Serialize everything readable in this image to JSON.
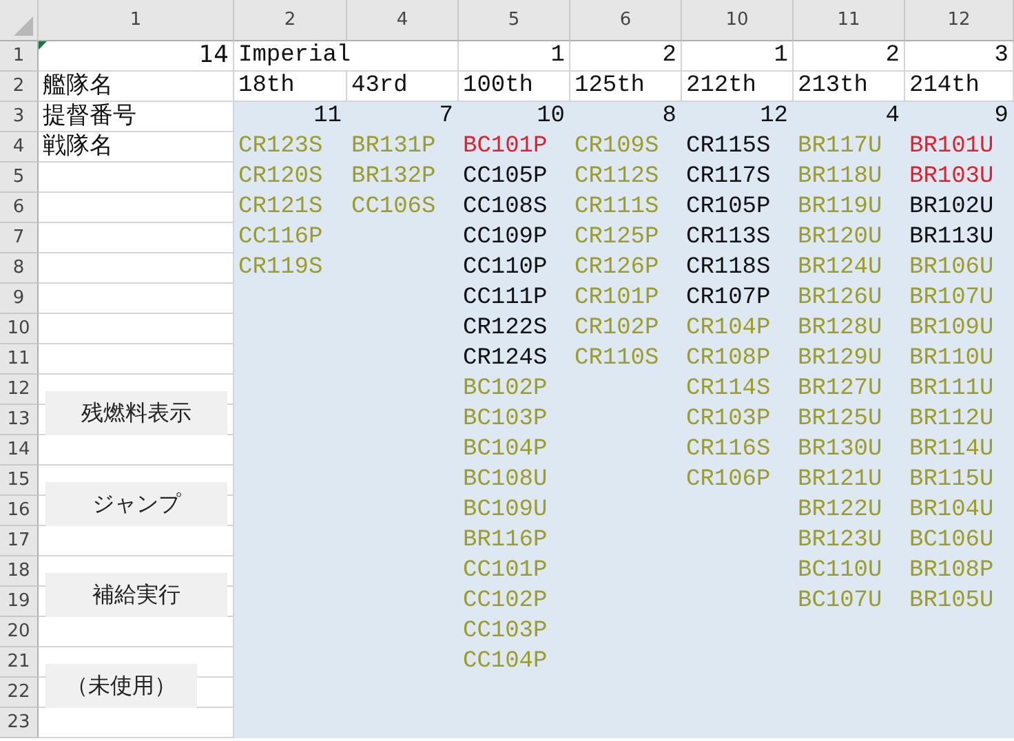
{
  "column_headers": [
    "1",
    "2",
    "4",
    "5",
    "6",
    "10",
    "11",
    "12"
  ],
  "row_headers": [
    "1",
    "2",
    "3",
    "4",
    "5",
    "6",
    "7",
    "8",
    "9",
    "10",
    "11",
    "12",
    "13",
    "14",
    "15",
    "16",
    "17",
    "18",
    "19",
    "20",
    "21",
    "22",
    "23"
  ],
  "label_column": {
    "row_1": "14",
    "row_labels": [
      "艦隊名",
      "提督番号",
      "戦隊名"
    ]
  },
  "sheet_buttons": [
    "残燃料表示",
    "ジャンプ",
    "補給実行",
    "（未使用）"
  ],
  "fleets": [
    {
      "row_1": "Imperial",
      "name": "18th",
      "admiral": "11",
      "units": [
        {
          "text": "CR123S",
          "color": "#9c9c28"
        },
        {
          "text": "CR120S",
          "color": "#9c9c28"
        },
        {
          "text": "CR121S",
          "color": "#9c9c28"
        },
        {
          "text": "CC116P",
          "color": "#9c9c28"
        },
        {
          "text": "CR119S",
          "color": "#9c9c28"
        }
      ]
    },
    {
      "name": "43rd",
      "admiral": "7",
      "units": [
        {
          "text": "BR131P",
          "color": "#9c9c28"
        },
        {
          "text": "BR132P",
          "color": "#9c9c28"
        },
        {
          "text": "CC106S",
          "color": "#9c9c28"
        }
      ]
    },
    {
      "row_1": "1",
      "name": "100th",
      "admiral": "10",
      "units": [
        {
          "text": "BC101P",
          "color": "#e0202c"
        },
        {
          "text": "CC105P",
          "color": "#111111"
        },
        {
          "text": "CC108S",
          "color": "#111111"
        },
        {
          "text": "CC109P",
          "color": "#111111"
        },
        {
          "text": "CC110P",
          "color": "#111111"
        },
        {
          "text": "CC111P",
          "color": "#111111"
        },
        {
          "text": "CR122S",
          "color": "#111111"
        },
        {
          "text": "CR124S",
          "color": "#111111"
        },
        {
          "text": "BC102P",
          "color": "#9c9c28"
        },
        {
          "text": "BC103P",
          "color": "#9c9c28"
        },
        {
          "text": "BC104P",
          "color": "#9c9c28"
        },
        {
          "text": "BC108U",
          "color": "#9c9c28"
        },
        {
          "text": "BC109U",
          "color": "#9c9c28"
        },
        {
          "text": "BR116P",
          "color": "#9c9c28"
        },
        {
          "text": "CC101P",
          "color": "#9c9c28"
        },
        {
          "text": "CC102P",
          "color": "#9c9c28"
        },
        {
          "text": "CC103P",
          "color": "#9c9c28"
        },
        {
          "text": "CC104P",
          "color": "#9c9c28"
        }
      ]
    },
    {
      "row_1": "2",
      "name": "125th",
      "admiral": "8",
      "units": [
        {
          "text": "CR109S",
          "color": "#9c9c28"
        },
        {
          "text": "CR112S",
          "color": "#9c9c28"
        },
        {
          "text": "CR111S",
          "color": "#9c9c28"
        },
        {
          "text": "CR125P",
          "color": "#9c9c28"
        },
        {
          "text": "CR126P",
          "color": "#9c9c28"
        },
        {
          "text": "CR101P",
          "color": "#9c9c28"
        },
        {
          "text": "CR102P",
          "color": "#9c9c28"
        },
        {
          "text": "CR110S",
          "color": "#9c9c28"
        }
      ]
    },
    {
      "row_1": "1",
      "name": "212th",
      "admiral": "12",
      "units": [
        {
          "text": "CR115S",
          "color": "#111111"
        },
        {
          "text": "CR117S",
          "color": "#111111"
        },
        {
          "text": "CR105P",
          "color": "#111111"
        },
        {
          "text": "CR113S",
          "color": "#111111"
        },
        {
          "text": "CR118S",
          "color": "#111111"
        },
        {
          "text": "CR107P",
          "color": "#111111"
        },
        {
          "text": "CR104P",
          "color": "#9c9c28"
        },
        {
          "text": "CR108P",
          "color": "#9c9c28"
        },
        {
          "text": "CR114S",
          "color": "#9c9c28"
        },
        {
          "text": "CR103P",
          "color": "#9c9c28"
        },
        {
          "text": "CR116S",
          "color": "#9c9c28"
        },
        {
          "text": "CR106P",
          "color": "#9c9c28"
        }
      ]
    },
    {
      "row_1": "2",
      "name": "213th",
      "admiral": "4",
      "units": [
        {
          "text": "BR117U",
          "color": "#9c9c28"
        },
        {
          "text": "BR118U",
          "color": "#9c9c28"
        },
        {
          "text": "BR119U",
          "color": "#9c9c28"
        },
        {
          "text": "BR120U",
          "color": "#9c9c28"
        },
        {
          "text": "BR124U",
          "color": "#9c9c28"
        },
        {
          "text": "BR126U",
          "color": "#9c9c28"
        },
        {
          "text": "BR128U",
          "color": "#9c9c28"
        },
        {
          "text": "BR129U",
          "color": "#9c9c28"
        },
        {
          "text": "BR127U",
          "color": "#9c9c28"
        },
        {
          "text": "BR125U",
          "color": "#9c9c28"
        },
        {
          "text": "BR130U",
          "color": "#9c9c28"
        },
        {
          "text": "BR121U",
          "color": "#9c9c28"
        },
        {
          "text": "BR122U",
          "color": "#9c9c28"
        },
        {
          "text": "BR123U",
          "color": "#9c9c28"
        },
        {
          "text": "BC110U",
          "color": "#9c9c28"
        },
        {
          "text": "BC107U",
          "color": "#9c9c28"
        }
      ]
    },
    {
      "row_1": "3",
      "name": "214th",
      "admiral": "9",
      "units": [
        {
          "text": "BR101U",
          "color": "#e0202c"
        },
        {
          "text": "BR103U",
          "color": "#e0202c"
        },
        {
          "text": "BR102U",
          "color": "#111111"
        },
        {
          "text": "BR113U",
          "color": "#111111"
        },
        {
          "text": "BR106U",
          "color": "#9c9c28"
        },
        {
          "text": "BR107U",
          "color": "#9c9c28"
        },
        {
          "text": "BR109U",
          "color": "#9c9c28"
        },
        {
          "text": "BR110U",
          "color": "#9c9c28"
        },
        {
          "text": "BR111U",
          "color": "#9c9c28"
        },
        {
          "text": "BR112U",
          "color": "#9c9c28"
        },
        {
          "text": "BR114U",
          "color": "#9c9c28"
        },
        {
          "text": "BR115U",
          "color": "#9c9c28"
        },
        {
          "text": "BR104U",
          "color": "#9c9c28"
        },
        {
          "text": "BC106U",
          "color": "#9c9c28"
        },
        {
          "text": "BR108P",
          "color": "#9c9c28"
        },
        {
          "text": "BR105U",
          "color": "#9c9c28"
        }
      ]
    }
  ]
}
